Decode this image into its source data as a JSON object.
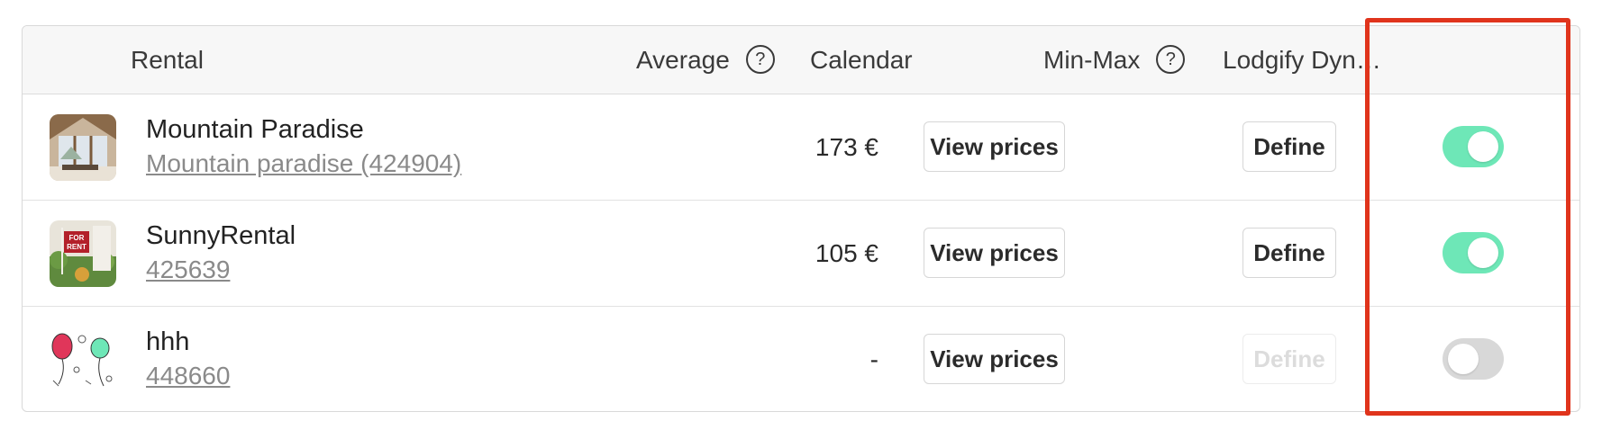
{
  "header": {
    "rental": "Rental",
    "average": "Average",
    "average_help": "?",
    "calendar": "Calendar",
    "minmax": "Min-Max",
    "minmax_help": "?",
    "lodgify": "Lodgify Dyn…"
  },
  "rows": [
    {
      "name": "Mountain Paradise",
      "sub": "Mountain paradise (424904)",
      "average": "173 €",
      "view_label": "View prices",
      "define_label": "Define",
      "define_enabled": true,
      "toggle_on": true
    },
    {
      "name": "SunnyRental",
      "sub": "425639",
      "average": "105 €",
      "view_label": "View prices",
      "define_label": "Define",
      "define_enabled": true,
      "toggle_on": true
    },
    {
      "name": "hhh",
      "sub": "448660",
      "average": "-",
      "view_label": "View prices",
      "define_label": "Define",
      "define_enabled": false,
      "toggle_on": false
    }
  ],
  "colors": {
    "toggle_on": "#6ee7b7",
    "toggle_off": "#d8d8d8",
    "highlight": "#e0341c"
  }
}
